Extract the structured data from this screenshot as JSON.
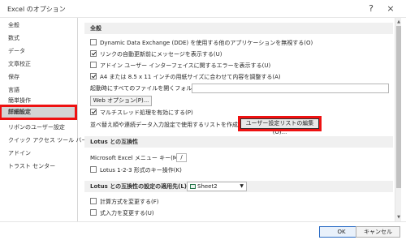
{
  "window": {
    "title": "Excel のオプション",
    "help_glyph": "?",
    "close_glyph": "×"
  },
  "sidebar": {
    "items": [
      {
        "label": "全般"
      },
      {
        "label": "数式"
      },
      {
        "label": "データ"
      },
      {
        "label": "文章校正"
      },
      {
        "label": "保存"
      },
      {
        "label": "言語"
      },
      {
        "label": "簡単操作"
      },
      {
        "label": "詳細設定",
        "selected": true
      },
      {
        "label": "リボンのユーザー設定"
      },
      {
        "label": "クイック アクセス ツール バー"
      },
      {
        "label": "アドイン"
      },
      {
        "label": "トラスト センター"
      }
    ]
  },
  "general": {
    "header": "全般",
    "options": [
      {
        "label": "Dynamic Data Exchange (DDE) を使用する他のアプリケーションを無視する(O)",
        "checked": false
      },
      {
        "label": "リンクの自動更新前にメッセージを表示する(U)",
        "checked": true
      },
      {
        "label": "アドイン ユーザー インターフェイスに関するエラーを表示する(U)",
        "checked": false
      },
      {
        "label": "A4 または 8.5 x 11 インチの用紙サイズに合わせて内容を調整する(A)",
        "checked": true
      }
    ],
    "startup_label": "起動時にすべてのファイルを開くフォルダー(L):",
    "startup_value": "",
    "web_options_button": "Web オプション(P)...",
    "multithread": {
      "label": "マルチスレッド処理を有効にする(P)",
      "checked": true
    },
    "custom_list_label": "並べ替え順や連続データ入力設定で使用するリストを作成します:",
    "custom_list_button": "ユーザー設定リストの編集(O)..."
  },
  "lotus": {
    "header": "Lotus との互換性",
    "menu_key_label": "Microsoft Excel メニュー キー(M):",
    "menu_key_value": "/",
    "nav_keys": {
      "label": "Lotus 1-2-3 形式のキー操作(K)",
      "checked": false
    }
  },
  "lotus_settings": {
    "header": "Lotus との互換性の設定の適用先(L):",
    "sheet_value": "Sheet2",
    "dropdown_glyph": "▼",
    "options": [
      {
        "label": "計算方式を変更する(F)",
        "checked": false
      },
      {
        "label": "式入力を変更する(U)",
        "checked": false
      }
    ]
  },
  "footer": {
    "ok": "OK",
    "cancel": "キャンセル"
  },
  "colors": {
    "highlight": "#ee1111",
    "selected_bg": "#d4d4d4",
    "section_bg": "#f0f0f0"
  }
}
